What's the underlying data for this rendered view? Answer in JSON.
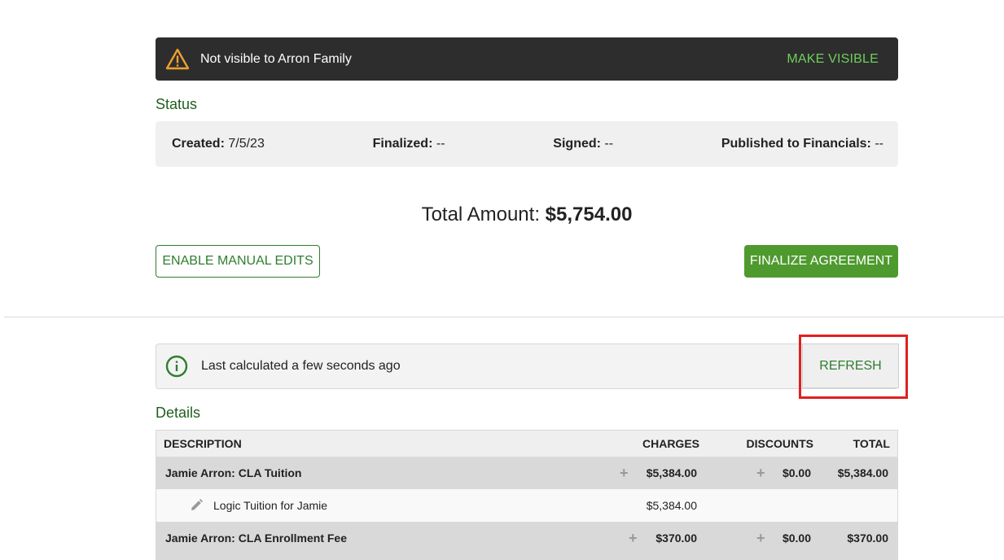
{
  "banner": {
    "text": "Not visible to Arron Family",
    "action": "MAKE VISIBLE",
    "icon": "warning-icon"
  },
  "status": {
    "title": "Status",
    "created_label": "Created:",
    "created_value": "7/5/23",
    "finalized_label": "Finalized:",
    "finalized_value": "--",
    "signed_label": "Signed:",
    "signed_value": "--",
    "published_label": "Published to Financials:",
    "published_value": "--"
  },
  "total": {
    "label": "Total Amount:",
    "value": "$5,754.00"
  },
  "actions": {
    "manual_edits": "ENABLE MANUAL EDITS",
    "finalize": "FINALIZE AGREEMENT"
  },
  "calculation": {
    "text": "Last calculated a few seconds ago",
    "refresh": "REFRESH",
    "icon": "info-icon"
  },
  "details": {
    "title": "Details",
    "columns": {
      "description": "DESCRIPTION",
      "charges": "CHARGES",
      "discounts": "DISCOUNTS",
      "total": "TOTAL"
    },
    "rows": [
      {
        "description": "Jamie Arron: CLA Tuition",
        "charges": "$5,384.00",
        "discounts": "$0.00",
        "total": "$5,384.00"
      },
      {
        "description": "Logic Tuition for Jamie",
        "charges": "$5,384.00"
      },
      {
        "description": "Jamie Arron: CLA Enrollment Fee",
        "charges": "$370.00",
        "discounts": "$0.00",
        "total": "$370.00"
      }
    ]
  },
  "colors": {
    "accent_green": "#4e9a2e",
    "text_green": "#2f7d2f",
    "banner_bg": "#2d2d2d",
    "highlight_red": "#e02020"
  }
}
